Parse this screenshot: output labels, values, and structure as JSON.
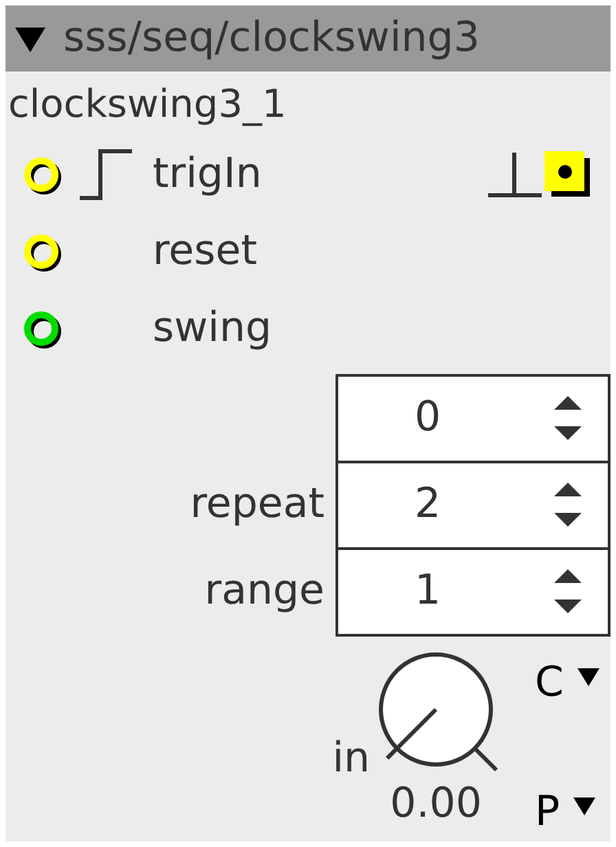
{
  "title": "sss/seq/clockswing3",
  "collapsed": false,
  "instance_name": "clockswing3_1",
  "inlets": [
    {
      "label": "trigIn",
      "color": "#ffff00",
      "trigger": true
    },
    {
      "label": "reset",
      "color": "#ffff00",
      "trigger": false
    },
    {
      "label": "swing",
      "color": "#00dd00",
      "trigger": false
    }
  ],
  "outlet": {
    "color": "#ffff00",
    "trigger": true
  },
  "spinboxes": [
    {
      "value": "0"
    },
    {
      "label": "repeat",
      "value": "2"
    },
    {
      "label": "range",
      "value": "1"
    }
  ],
  "knob": {
    "label": "in",
    "reading": "0.00"
  },
  "menus": [
    {
      "label": "C"
    },
    {
      "label": "P"
    }
  ]
}
